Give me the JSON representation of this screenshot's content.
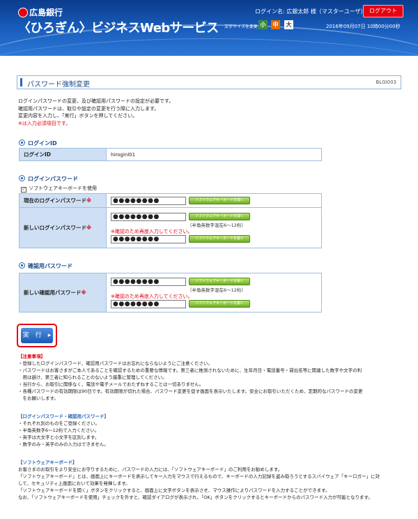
{
  "header": {
    "bank_name": "広島銀行",
    "service_name": "〈ひろぎん〉ビジネスWebサービス",
    "login_name": "ログイン名: 広銀太郎 様（マスターユーザ）",
    "logout_label": "ログアウト",
    "font_size_label": "文字サイズを変更",
    "font_small": "小",
    "font_medium": "中",
    "font_large": "大",
    "datetime": "2016年09月07日 10時00分00秒"
  },
  "page": {
    "title": "パスワード強制変更",
    "screen_id": "BLGI003",
    "intro": [
      "ログインパスワードの変更、及び確認用パスワードの設定が必要です。",
      "確認用パスワードは、取引や設定の変更を行う際に入力します。",
      "変更内容を入力し、「実行」ボタンを押してください。",
      "※は入力必須項目です。"
    ]
  },
  "login_id_section": {
    "heading": "ログインID",
    "label": "ログインID",
    "value": "hiroginl01"
  },
  "login_pw_section": {
    "heading": "ログインパスワード",
    "software_kb_checkbox": "ソフトウェアキーボードを使用",
    "current_label": "現在のログインパスワード",
    "new_label": "新しいログインパスワード",
    "required_mark": "※",
    "masked": "●●●●●●●●",
    "kb_button": "ソフトウェアキーボードを開く",
    "hint": "（半角英数字混在6～12桁）",
    "confirm_note": "※確認のため再度入力してください。"
  },
  "confirm_pw_section": {
    "heading": "確認用パスワード",
    "new_label": "新しい確認用パスワード",
    "required_mark": "※",
    "masked": "●●●●●●●●",
    "kb_button": "ソフトウェアキーボードを開く",
    "hint": "（半角英数字混在6～12桁）",
    "confirm_note": "※確認のため再度入力してください。"
  },
  "actions": {
    "execute_label": "実　行　▸"
  },
  "notes": {
    "caution_heading": "【注意事項】",
    "caution": [
      "・登録したログインパスワード、確認用パスワードはお忘れにならないようにご注意ください。",
      "・パスワードはお客さまがご本人であることを確認するための重要な情報です。第三者に推測されないために、生年月日・電話番号・貸出名等に関連した数字や文字の利",
      "　用は避け、第三者に知られることのないよう厳重に管理してください。",
      "・当行から、お取引に関係なく、電話や電子メールでおたずねすることは一切ありません。",
      "・各種パスワードの有効期限は90日です。有効期限が切れた場合、パスワード変更を促す画面を表示いたします。安全にお取引いただくため、定期的なパスワードの変更",
      "　をお願いします。"
    ],
    "pw_heading": "【ログインパスワード・確認用パスワード】",
    "pw_rules": [
      "・それぞれ別のものをご登録ください。",
      "・半角英数字6～12桁で入力ください。",
      "・英字は大文字と小文字を区別します。",
      "・数字のみ・英字のみの入力はできません。"
    ],
    "kb_heading": "【ソフトウェアキーボード】",
    "kb_text": [
      "お客さまのお取引をより安全にお守りするために、パスワードの入力には、「ソフトウェアキーボード」のご利用をお勧めします。",
      "「ソフトウェアキーボード」とは、画面上にキーボードを表示してキー入力をマウスで行えるもので、キーボードの入力記録を盗み取ろうとするスパイウェア「キーロガー」に対",
      "して、セキュリティ上画面において効果を発揮します。",
      "「ソフトウェアキーボードを開く」ボタンをクリックすると、画面上に文字ボタンを表示させ、マウス操作によりパスワードを入力することができます。",
      "なお、「ソフトウェアキーボードを使用」チェックを外すと、確認ダイアログが表示され、「OK」ボタンをクリックするとキーボードからのパスワード入力が可能となります。"
    ]
  }
}
